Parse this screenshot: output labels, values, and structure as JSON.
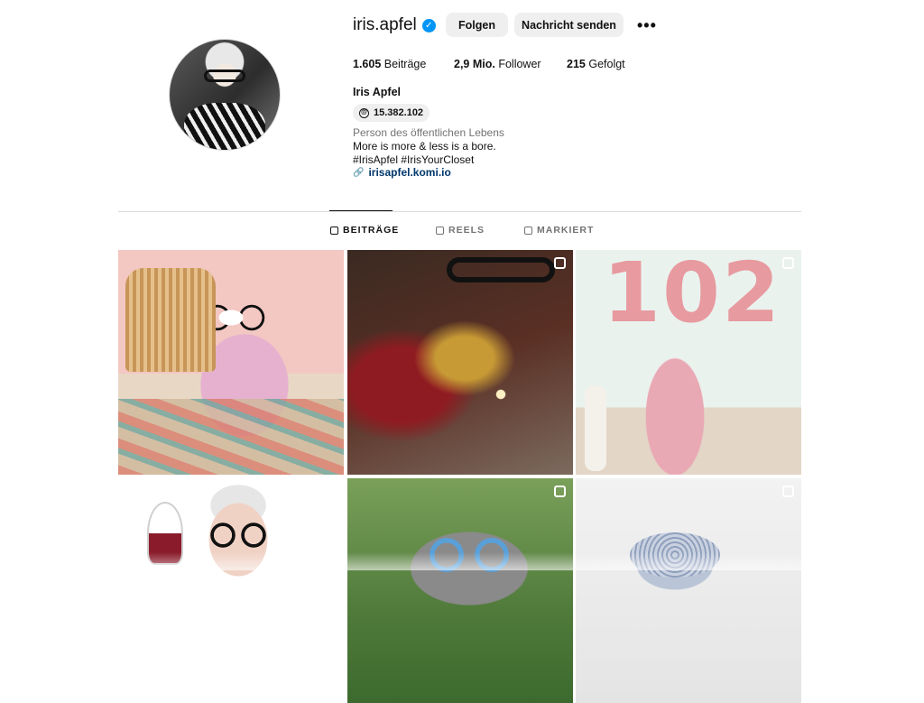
{
  "profile": {
    "username": "iris.apfel",
    "verified": true,
    "full_name": "Iris Apfel",
    "threads_count": "15.382.102",
    "category": "Person des öffentlichen Lebens",
    "bio_lines": [
      "More is more & less is a bore.",
      "#IrisApfel #IrisYourCloset"
    ],
    "link": "irisapfel.komi.io"
  },
  "actions": {
    "follow_label": "Folgen",
    "message_label": "Nachricht senden",
    "more_label": "•••"
  },
  "stats": {
    "posts_value": "1.605",
    "posts_label": "Beiträge",
    "followers_value": "2,9 Mio.",
    "followers_label": "Follower",
    "following_value": "215",
    "following_label": "Gefolgt"
  },
  "tabs": [
    {
      "label": "BEITRÄGE",
      "active": true,
      "icon": "grid-icon"
    },
    {
      "label": "REELS",
      "active": false,
      "icon": "reels-icon"
    },
    {
      "label": "MARKIERT",
      "active": false,
      "icon": "tagged-icon"
    }
  ],
  "grid": [
    {
      "kind": "post",
      "badge": null
    },
    {
      "kind": "reel",
      "badge": "reels-icon"
    },
    {
      "kind": "reel",
      "badge": "reels-icon"
    },
    {
      "kind": "post",
      "badge": null
    },
    {
      "kind": "carousel",
      "badge": "carousel-icon"
    },
    {
      "kind": "reel",
      "badge": "reels-icon"
    }
  ],
  "colors": {
    "verified": "#0095f6",
    "link": "#00376b",
    "button_bg": "#efefef",
    "muted": "#737373"
  }
}
